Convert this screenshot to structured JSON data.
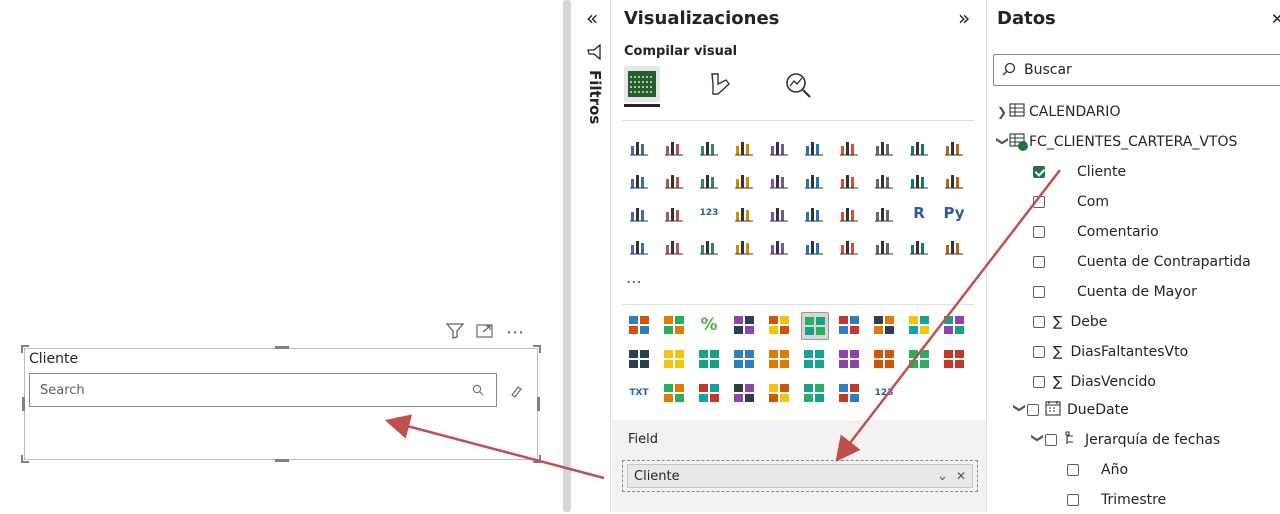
{
  "canvas": {
    "slicer": {
      "title": "Cliente",
      "search_placeholder": "Search",
      "header_icons": [
        "filter-icon",
        "focus-mode-icon",
        "more-options-icon"
      ],
      "more_label": "⋯"
    }
  },
  "filters_pane": {
    "label": "Filtros",
    "collapse_glyph": "«"
  },
  "visualizations_pane": {
    "title": "Visualizaciones",
    "expand_glyph": "»",
    "build_visual_label": "Compilar visual",
    "modes": [
      "build-visual-icon",
      "format-visual-icon",
      "analytics-icon"
    ],
    "gallery": [
      [
        "stacked-bar",
        "clustered-column",
        "stacked-bar-100",
        "stacked-column",
        "clustered-bar",
        "column-100",
        "line",
        "area",
        "stacked-area",
        "line-clustered-column"
      ],
      [
        "line-stacked-column",
        "ribbon",
        "waterfall",
        "funnel",
        "scatter",
        "pie",
        "donut",
        "treemap",
        "map",
        "filled-map"
      ],
      [
        "azure-map",
        "gauge",
        "card",
        "multi-row-card",
        "kpi",
        "slicer",
        "table",
        "matrix",
        "r-visual",
        "python-visual"
      ],
      [
        "key-influencers",
        "decomposition-tree",
        "qa",
        "smart-narrative",
        "goals",
        "paginated-report",
        "power-apps",
        "power-automate",
        "diamond",
        "chevron"
      ]
    ],
    "gallery_text": {
      "r-visual": "R",
      "python-visual": "Py",
      "card": "123"
    },
    "more_glyph": "⋯",
    "custom_gallery": [
      [
        "custom-1",
        "custom-2",
        "custom-3",
        "custom-4",
        "custom-5",
        "custom-6",
        "custom-7",
        "custom-8",
        "custom-9",
        "custom-10"
      ],
      [
        "custom-11",
        "custom-12",
        "custom-13",
        "custom-14",
        "custom-15",
        "custom-16",
        "custom-17",
        "custom-18",
        "custom-19",
        "custom-20"
      ],
      [
        "custom-21",
        "custom-22",
        "custom-23",
        "custom-24",
        "custom-25",
        "custom-26",
        "custom-27",
        "custom-28"
      ]
    ],
    "custom_text": {
      "custom-3": "%",
      "custom-21": "TXT",
      "custom-28": "123"
    },
    "field_well": {
      "label": "Field",
      "value": "Cliente",
      "chevron": "⌄",
      "remove": "✕"
    }
  },
  "data_pane": {
    "title": "Datos",
    "close_glyph": "✕",
    "search_placeholder": "Buscar",
    "tables": [
      {
        "name": "CALENDARIO",
        "expanded": false
      },
      {
        "name": "FC_CLIENTES_CARTERA_VTOS",
        "expanded": true
      }
    ],
    "fields": [
      {
        "label": "Cliente",
        "checked": true,
        "sigma": false
      },
      {
        "label": "Com",
        "checked": false,
        "sigma": false
      },
      {
        "label": "Comentario",
        "checked": false,
        "sigma": false
      },
      {
        "label": "Cuenta de Contrapartida",
        "checked": false,
        "sigma": false
      },
      {
        "label": "Cuenta de Mayor",
        "checked": false,
        "sigma": false
      },
      {
        "label": "Debe",
        "checked": false,
        "sigma": true
      },
      {
        "label": "DiasFaltantesVto",
        "checked": false,
        "sigma": true
      },
      {
        "label": "DiasVencido",
        "checked": false,
        "sigma": true
      }
    ],
    "date_field": {
      "label": "DueDate",
      "hierarchy": "Jerarquía de fechas",
      "levels": [
        "Año",
        "Trimestre"
      ]
    },
    "sigma_glyph": "∑"
  },
  "colors": {
    "accent": "#217346",
    "arrow": "#c0504d",
    "selected_tile": "#d6d6d6"
  }
}
